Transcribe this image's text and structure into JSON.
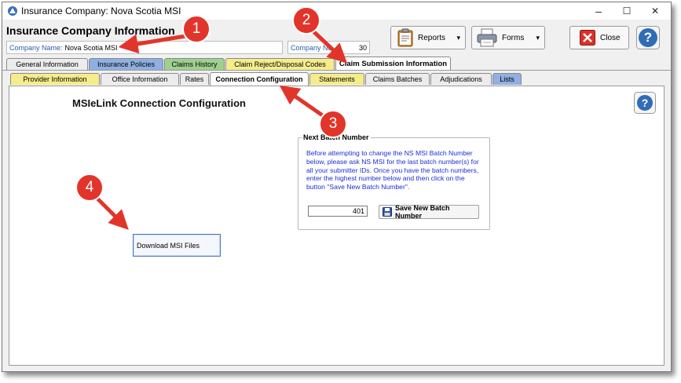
{
  "window": {
    "title": "Insurance Company:  Nova Scotia MSI",
    "controls": {
      "minimize": "–",
      "maximize": "☐",
      "close": "✕"
    }
  },
  "header": {
    "title": "Insurance Company Information",
    "company_name_label": "Company Name:",
    "company_name_value": "Nova Scotia MSI",
    "company_no_label": "Company No",
    "company_no_value": "30"
  },
  "toolbar": {
    "reports_label": "Reports",
    "forms_label": "Forms",
    "close_label": "Close",
    "dropdown_glyph": "▾",
    "help_glyph": "?"
  },
  "main_tabs": [
    {
      "label": "General Information",
      "color": "#ececec"
    },
    {
      "label": "Insurance Policies",
      "color": "#8fb0e0"
    },
    {
      "label": "Claims History",
      "color": "#9fd08f"
    },
    {
      "label": "Claim Reject/Disposal Codes",
      "color": "#f5ec8c"
    },
    {
      "label": "Claim Submission Information",
      "color": "#ffffff",
      "active": true
    }
  ],
  "sub_tabs": [
    {
      "label": "Provider Information",
      "color": "#f5ec8c"
    },
    {
      "label": "Office Information",
      "color": "#ececec"
    },
    {
      "label": "Rates",
      "color": "#ececec"
    },
    {
      "label": "Connection Configuration",
      "color": "#ffffff",
      "active": true
    },
    {
      "label": "Statements",
      "color": "#f5ec8c"
    },
    {
      "label": "Claims Batches",
      "color": "#ececec"
    },
    {
      "label": "Adjudications",
      "color": "#ececec"
    },
    {
      "label": "Lists",
      "color": "#8fb0e0"
    }
  ],
  "content": {
    "section_title": "MSIeLink Connection Configuration",
    "group_title": "Next Batch Number",
    "instructions": "Before attempting to change the NS MSI Batch Number below, please ask NS MSI for the last batch number(s) for all your submitter IDs.  Once you have the batch numbers, enter the highest number below and then click on the button \"Save New Batch Number\".",
    "batch_number_value": "401",
    "save_button_label": "Save New Batch Number",
    "download_button_label": "Download MSI Files",
    "help_glyph": "?"
  },
  "annotations": [
    {
      "number": "1"
    },
    {
      "number": "2"
    },
    {
      "number": "3"
    },
    {
      "number": "4"
    }
  ],
  "colors": {
    "annotation_red": "#e1352b",
    "label_blue": "#2a5db0",
    "instruction_blue": "#1b2fd6",
    "help_blue": "#2f6db5"
  }
}
